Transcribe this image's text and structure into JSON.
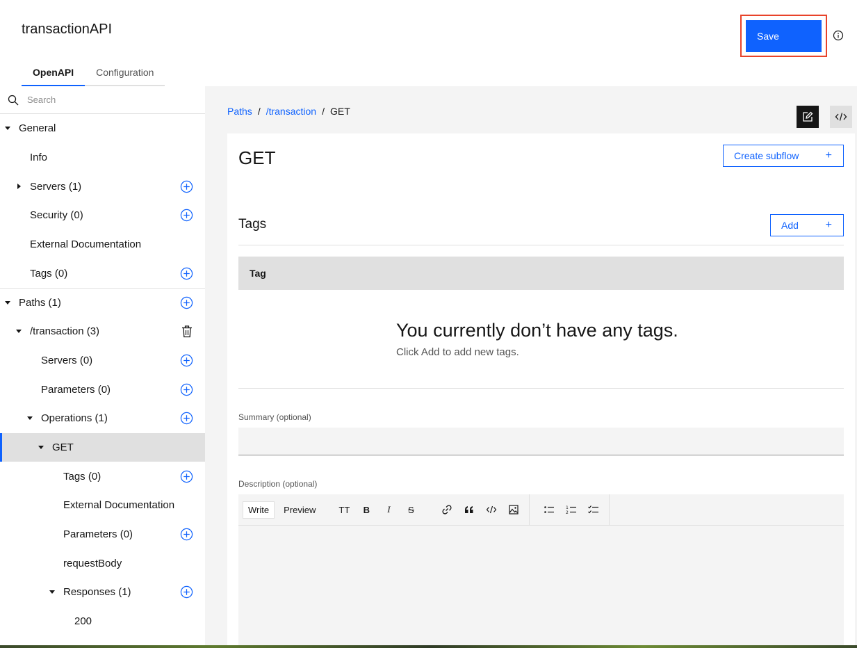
{
  "app": {
    "title": "transactionAPI"
  },
  "header": {
    "save_label": "Save"
  },
  "tabs": [
    {
      "label": "OpenAPI",
      "active": true
    },
    {
      "label": "Configuration",
      "active": false
    }
  ],
  "sidebar": {
    "search_placeholder": "Search",
    "items": {
      "general": "General",
      "info": "Info",
      "servers": "Servers (1)",
      "security": "Security (0)",
      "external_docs": "External Documentation",
      "tags": "Tags (0)",
      "paths": "Paths (1)",
      "transaction": "/transaction (3)",
      "path_servers": "Servers (0)",
      "path_parameters": "Parameters (0)",
      "operations": "Operations (1)",
      "get": "GET",
      "op_tags": "Tags (0)",
      "op_external_docs": "External Documentation",
      "op_parameters": "Parameters (0)",
      "op_request_body": "requestBody",
      "op_responses": "Responses (1)",
      "response_200": "200"
    }
  },
  "breadcrumb": {
    "paths": "Paths",
    "transaction": "/transaction",
    "current": "GET",
    "separator": "/"
  },
  "operation": {
    "title": "GET",
    "create_subflow_label": "Create subflow",
    "tags_title": "Tags",
    "add_label": "Add",
    "table_header": "Tag",
    "empty_title": "You currently don’t have any tags.",
    "empty_subtitle": "Click Add to add new tags.",
    "summary_label": "Summary (optional)",
    "summary_value": "",
    "description_label": "Description (optional)"
  },
  "editor_toolbar": {
    "write": "Write",
    "preview": "Preview",
    "heading": "TT",
    "bold": "B",
    "italic": "I",
    "strikethrough": "S"
  },
  "colors": {
    "accent": "#0f62fe",
    "highlight_border": "#e8432a",
    "selected_bg": "#e0e0e0"
  }
}
